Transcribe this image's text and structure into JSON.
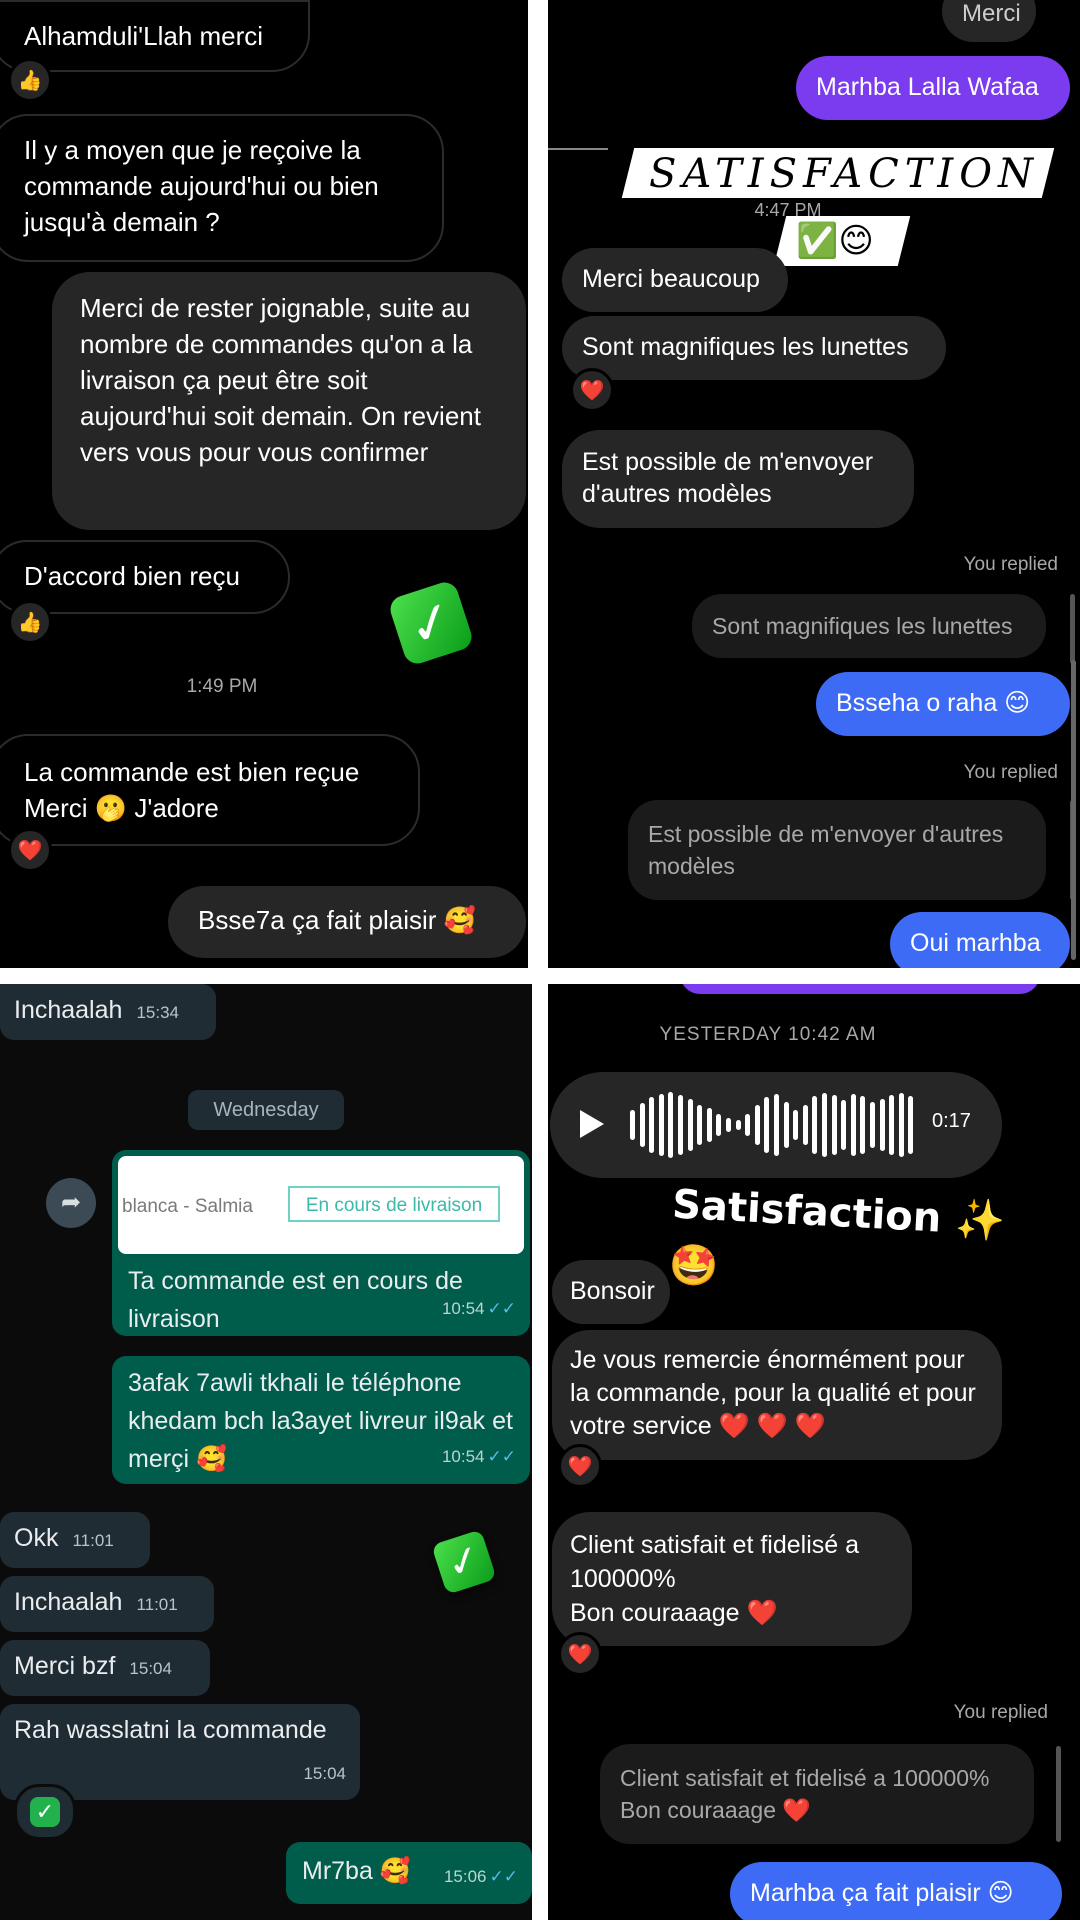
{
  "colors": {
    "instagram_purple": "#7b3cf0",
    "instagram_blue": "#3d6bf5",
    "whatsapp_green": "#005c4b",
    "whatsapp_gray": "#202c33",
    "check_green": "#22b14c"
  },
  "panel1": {
    "msg1": "Alhamduli'Llah merci",
    "msg2": "Il y a moyen que je reçoive la commande aujourd'hui ou bien jusqu'à demain ?",
    "msg3": "Merci de rester joignable, suite au nombre de commandes qu'on a la livraison ça peut être soit aujourd'hui soit demain. On revient vers vous pour vous confirmer",
    "msg4": "D'accord bien reçu",
    "time": "1:49 PM",
    "msg5_line1": "La commande est bien reçue",
    "msg5_line2": "Merci 🫢 J'adore",
    "msg6": "Bsse7a ça fait plaisir 🥰",
    "react_thumb": "👍",
    "react_heart": "❤️"
  },
  "panel2": {
    "msg_top": "Merci",
    "msg1": "Marhba Lalla Wafaa",
    "banner": "SATISFACTION",
    "time": "4:47 PM",
    "emoji_strip": "✅😊",
    "msg2": "Merci beaucoup",
    "msg3": "Sont magnifiques les lunettes",
    "msg4": "Est possible de m'envoyer d'autres modèles",
    "replied1": "You replied",
    "reply1": "Sont magnifiques les lunettes",
    "msg5": "Bsseha o raha 😊",
    "replied2": "You replied",
    "reply2": "Est possible de m'envoyer d'autres modèles",
    "msg6": "Oui marhba",
    "react_heart": "❤️"
  },
  "panel3": {
    "msg1": "Inchaalah",
    "msg1_time": "15:34",
    "date_chip": "Wednesday",
    "preview_text": "blanca - Salmia",
    "preview_badge": "En cours de livraison",
    "msg2": "Ta commande est en cours de livraison",
    "msg2_time": "10:54",
    "msg3": "3afak 7awli tkhali le téléphone khedam bch la3ayet livreur il9ak et merçi 🥰",
    "msg3_time": "10:54",
    "msg4": "Okk",
    "msg4_time": "11:01",
    "msg5": "Inchaalah",
    "msg5_time": "11:01",
    "msg6": "Merci bzf",
    "msg6_time": "15:04",
    "msg7": "Rah wasslatni la commande",
    "msg7_time": "15:04",
    "msg8": "Mr7ba 🥰",
    "msg8_time": "15:06",
    "read_mark": "✓✓",
    "react_check": "✓"
  },
  "panel4": {
    "date": "YESTERDAY 10:42 AM",
    "voice_duration": "0:17",
    "sticker": "Satisfaction ✨🤩",
    "msg1": "Bonsoir",
    "msg2": "Je vous remercie énormément pour la commande, pour la qualité et pour votre service ❤️ ❤️ ❤️",
    "msg3_line1": "Client satisfait et fidelisé a 100000%",
    "msg3_line2": "Bon couraaage ❤️",
    "replied": "You replied",
    "reply_line1": "Client satisfait et fidelisé a 100000%",
    "reply_line2": "Bon couraaage ❤️",
    "msg4": "Marhba ça fait plaisir 😊",
    "react_heart": "❤️"
  }
}
